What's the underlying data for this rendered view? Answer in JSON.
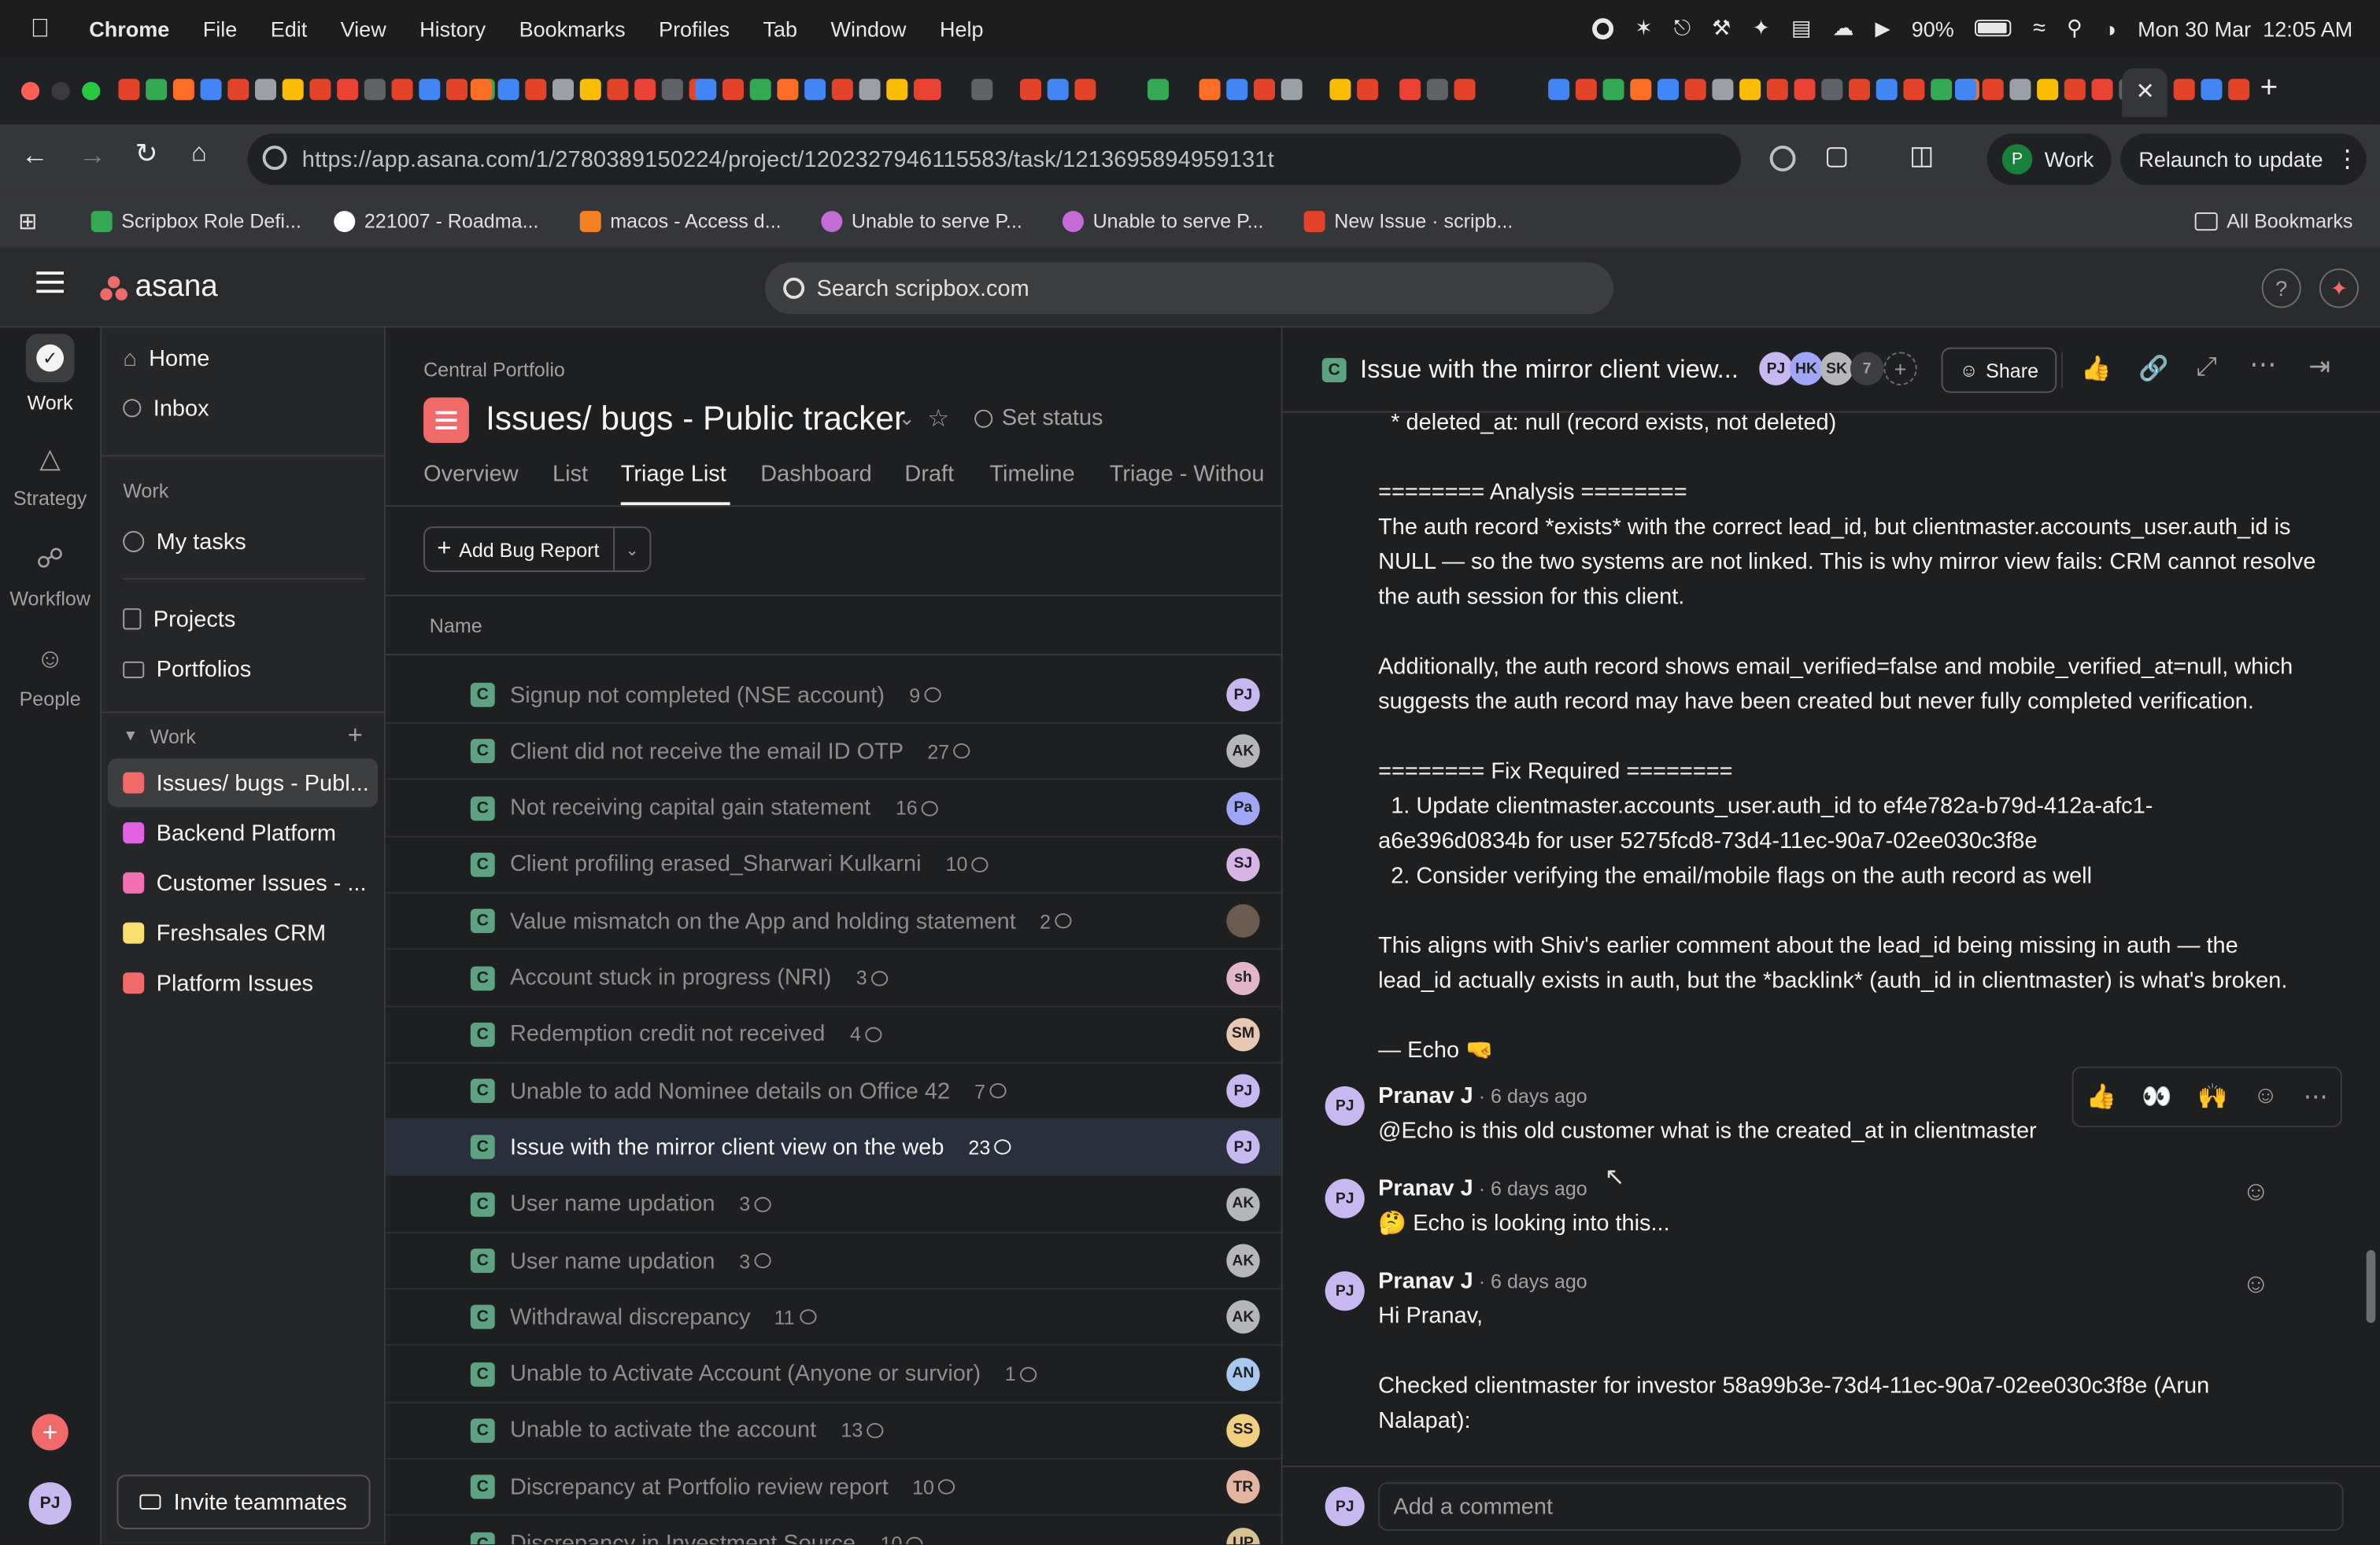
{
  "menubar": {
    "app": "Chrome",
    "items": [
      "File",
      "Edit",
      "View",
      "History",
      "Bookmarks",
      "Profiles",
      "Tab",
      "Window",
      "Help"
    ],
    "battery": "90%",
    "datetime": "Mon 30 Mar  12:05 AM"
  },
  "browser": {
    "url": "https://app.asana.com/1/2780389150224/project/1202327946115583/task/1213695894959131t",
    "profile": "Work",
    "profile_initial": "P",
    "relaunch": "Relaunch to update",
    "bookmarks": [
      "Scripbox Role Defi...",
      "221007 - Roadma...",
      "macos - Access d...",
      "Unable to serve P...",
      "Unable to serve P...",
      "New Issue · scripb..."
    ],
    "all_bookmarks": "All Bookmarks"
  },
  "asana": {
    "logo": "asana",
    "search_placeholder": "Search scripbox.com"
  },
  "rail": {
    "items": [
      "Work",
      "Strategy",
      "Workflow",
      "People"
    ],
    "user_initials": "PJ"
  },
  "sidebar": {
    "home": "Home",
    "inbox": "Inbox",
    "work_header": "Work",
    "my_tasks": "My tasks",
    "projects": "Projects",
    "portfolios": "Portfolios",
    "work_section": "Work",
    "project_list": [
      {
        "label": "Issues/ bugs - Publ...",
        "color": "#f06a6a"
      },
      {
        "label": "Backend Platform",
        "color": "#e362e3"
      },
      {
        "label": "Customer Issues - ...",
        "color": "#f26fb2"
      },
      {
        "label": "Freshsales CRM",
        "color": "#f8df72"
      },
      {
        "label": "Platform Issues",
        "color": "#f06a6a"
      }
    ],
    "invite": "Invite teammates"
  },
  "project": {
    "breadcrumb": "Central Portfolio",
    "title": "Issues/ bugs - Public tracker",
    "set_status": "Set status",
    "tabs": [
      "Overview",
      "List",
      "Triage List",
      "Dashboard",
      "Draft",
      "Timeline",
      "Triage - Withou"
    ],
    "active_tab": "Triage List",
    "add_button": "Add Bug Report",
    "column_name": "Name",
    "tasks": [
      {
        "name": "Signup not completed (NSE account)",
        "comments": "9",
        "assignee": "PJ",
        "color": "#c7b8f0"
      },
      {
        "name": "Client did not receive the email ID OTP",
        "comments": "27",
        "assignee": "AK",
        "color": "#b5b6b8"
      },
      {
        "name": "Not receiving capital gain statement",
        "comments": "16",
        "assignee": "Pa",
        "color": "#9fa6f5"
      },
      {
        "name": "Client profiling erased_Sharwari Kulkarni",
        "comments": "10",
        "assignee": "SJ",
        "color": "#d8b3e6"
      },
      {
        "name": "Value mismatch on the App and holding statement",
        "comments": "2",
        "assignee": "",
        "color": "#6b5b4e"
      },
      {
        "name": "Account stuck in progress (NRI)",
        "comments": "3",
        "assignee": "sh",
        "color": "#e3b5c8"
      },
      {
        "name": "Redemption credit not received",
        "comments": "4",
        "assignee": "SM",
        "color": "#e8c8b0"
      },
      {
        "name": "Unable to add Nominee details on Office 42",
        "comments": "7",
        "assignee": "PJ",
        "color": "#c7b8f0"
      },
      {
        "name": "Issue with the mirror client view on the web",
        "comments": "23",
        "assignee": "PJ",
        "color": "#c7b8f0",
        "selected": true
      },
      {
        "name": "User name updation",
        "comments": "3",
        "assignee": "AK",
        "color": "#b5b6b8"
      },
      {
        "name": "User name updation",
        "comments": "3",
        "assignee": "AK",
        "color": "#b5b6b8"
      },
      {
        "name": "Withdrawal discrepancy",
        "comments": "11",
        "assignee": "AK",
        "color": "#b5b6b8"
      },
      {
        "name": "Unable to Activate Account (Anyone or survior)",
        "comments": "1",
        "assignee": "AN",
        "color": "#a8c8f0"
      },
      {
        "name": "Unable to activate the account",
        "comments": "13",
        "assignee": "SS",
        "color": "#f0d080"
      },
      {
        "name": "Discrepancy at Portfolio review report",
        "comments": "10",
        "assignee": "TR",
        "color": "#e3b5a0"
      },
      {
        "name": "Discrepancy in Investment Source",
        "comments": "10",
        "assignee": "UP",
        "color": "#d8c090"
      }
    ]
  },
  "detail": {
    "title": "Issue with the mirror client view...",
    "collaborators": [
      "PJ",
      "HK",
      "SK"
    ],
    "collaborator_count": "7",
    "share": "Share",
    "body": [
      "  * deleted_at: null (record exists, not deleted)",
      "",
      "======== Analysis ========",
      "The auth record *exists* with the correct lead_id, but clientmaster.accounts_user.auth_id is",
      "NULL — so the two systems are not linked. This is why mirror view fails: CRM cannot resolve",
      "the auth session for this client.",
      "",
      "Additionally, the auth record shows email_verified=false and mobile_verified_at=null, which",
      "suggests the auth record may have been created but never fully completed verification.",
      "",
      "======== Fix Required ========",
      "  1. Update clientmaster.accounts_user.auth_id to ef4e782a-b79d-412a-afc1-",
      "a6e396d0834b for user 5275fcd8-73d4-11ec-90a7-02ee030c3f8e",
      "  2. Consider verifying the email/mobile flags on the auth record as well",
      "",
      "This aligns with Shiv's earlier comment about the lead_id being missing in auth — the",
      "lead_id actually exists in auth, but the *backlink* (auth_id in clientmaster) is what's broken.",
      "",
      "— Echo 🤜"
    ],
    "comments": [
      {
        "author": "Pranav J",
        "time": " · 6 days ago",
        "text": "@Echo is this old customer what is the created_at in clientmaster"
      },
      {
        "author": "Pranav J",
        "time": " · 6 days ago",
        "text": "🤔 Echo is looking into this..."
      },
      {
        "author": "Pranav J",
        "time": " · 6 days ago",
        "text": "Hi Pranav,\n\nChecked clientmaster for investor 58a99b3e-73d4-11ec-90a7-02ee030c3f8e (Arun\nNalapat):"
      }
    ],
    "reactions": [
      "👍",
      "👀",
      "🙌"
    ],
    "comment_placeholder": "Add a comment",
    "author_initials": "PJ"
  }
}
